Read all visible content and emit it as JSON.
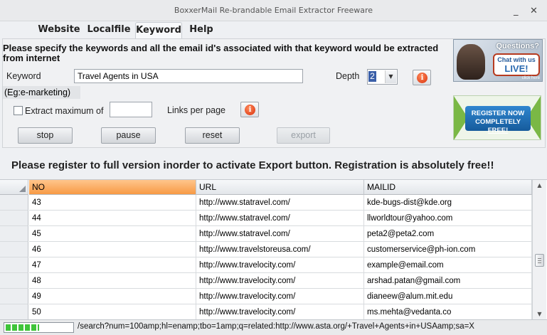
{
  "window": {
    "title": "BoxxerMail Re-brandable Email Extractor Freeware",
    "minimize": "_",
    "close": "✕"
  },
  "tabs": [
    {
      "label": "Website"
    },
    {
      "label": "Localfile"
    },
    {
      "label": "Keyword",
      "active": true
    },
    {
      "label": "Help"
    }
  ],
  "form": {
    "instructions": "Please specify the keywords and all the email id's associated with that keyword would be extracted from internet",
    "keyword_label": "Keyword",
    "keyword_value": "Travel Agents in USA",
    "example": "(Eg:e-marketing)",
    "depth_label": "Depth",
    "depth_value": "2",
    "extract_max_label": "Extract maximum of",
    "extract_max_checked": false,
    "extract_max_value": "",
    "links_per_page_label": "Links per page",
    "info_icon": "i"
  },
  "buttons": {
    "stop": "stop",
    "pause": "pause",
    "reset": "reset",
    "export": "export"
  },
  "ads": {
    "chat_questions": "Questions?",
    "chat_with_us": "Chat with us",
    "chat_live": "LIVE!",
    "chat_click": "click here",
    "register_line1": "REGISTER NOW",
    "register_line2": "COMPLETELY",
    "register_free": "FREE!"
  },
  "register_notice": "Please register to full version inorder to activate Export button. Registration is absolutely free!!",
  "table": {
    "columns": [
      "NO",
      "URL",
      "MAILID"
    ],
    "rows": [
      {
        "no": "43",
        "url": "http://www.statravel.com/",
        "mail": "kde-bugs-dist@kde.org"
      },
      {
        "no": "44",
        "url": "http://www.statravel.com/",
        "mail": "llworldtour@yahoo.com"
      },
      {
        "no": "45",
        "url": "http://www.statravel.com/",
        "mail": "peta2@peta2.com"
      },
      {
        "no": "46",
        "url": "http://www.travelstoreusa.com/",
        "mail": "customerservice@ph-ion.com"
      },
      {
        "no": "47",
        "url": "http://www.travelocity.com/",
        "mail": "example@email.com"
      },
      {
        "no": "48",
        "url": "http://www.travelocity.com/",
        "mail": "arshad.patan@gmail.com"
      },
      {
        "no": "49",
        "url": "http://www.travelocity.com/",
        "mail": "dianeew@alum.mit.edu"
      },
      {
        "no": "50",
        "url": "http://www.travelocity.com/",
        "mail": "ms.mehta@vedanta.co"
      }
    ],
    "scroll_up": "▲",
    "scroll_down": "▼",
    "scroll_position": 0.62
  },
  "status": {
    "progress_fraction": 0.5,
    "progress_segments": 5,
    "text": "/search?num=100amp;hl=enamp;tbo=1amp;q=related:http://www.asta.org/+Travel+Agents+in+USAamp;sa=X"
  }
}
